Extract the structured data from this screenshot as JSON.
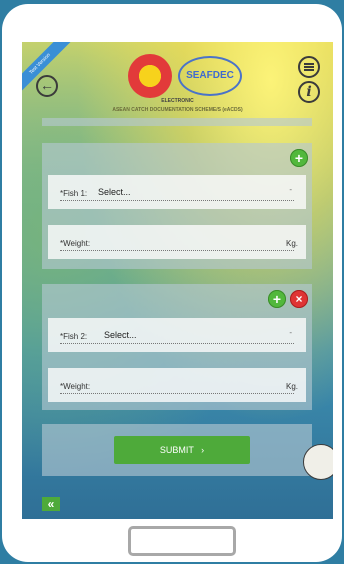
{
  "header": {
    "beta_ribbon": "Test Version",
    "logo_seafdec": "SEAFDEC",
    "app_title_line1": "ELECTRONIC",
    "app_title_line2": "ASEAN CATCH DOCUMENTATION SCHEME/S (eACDS)"
  },
  "fish_entries": [
    {
      "fish_label": "*Fish 1:",
      "fish_value": "Select...",
      "weight_label": "*Weight:",
      "weight_unit": "Kg."
    },
    {
      "fish_label": "*Fish 2:",
      "fish_value": "Select...",
      "weight_label": "*Weight:",
      "weight_unit": "Kg."
    }
  ],
  "buttons": {
    "add_icon": "+",
    "remove_icon": "×",
    "submit_label": "SUBMIT",
    "submit_chevron": "›",
    "collapse_icon": "«"
  },
  "icons": {
    "back": "arrow-left-circle-icon",
    "menu": "hamburger-menu-icon",
    "info": "info-icon"
  },
  "colors": {
    "accent_green": "#4eaa3a",
    "remove_red": "#df3434"
  }
}
